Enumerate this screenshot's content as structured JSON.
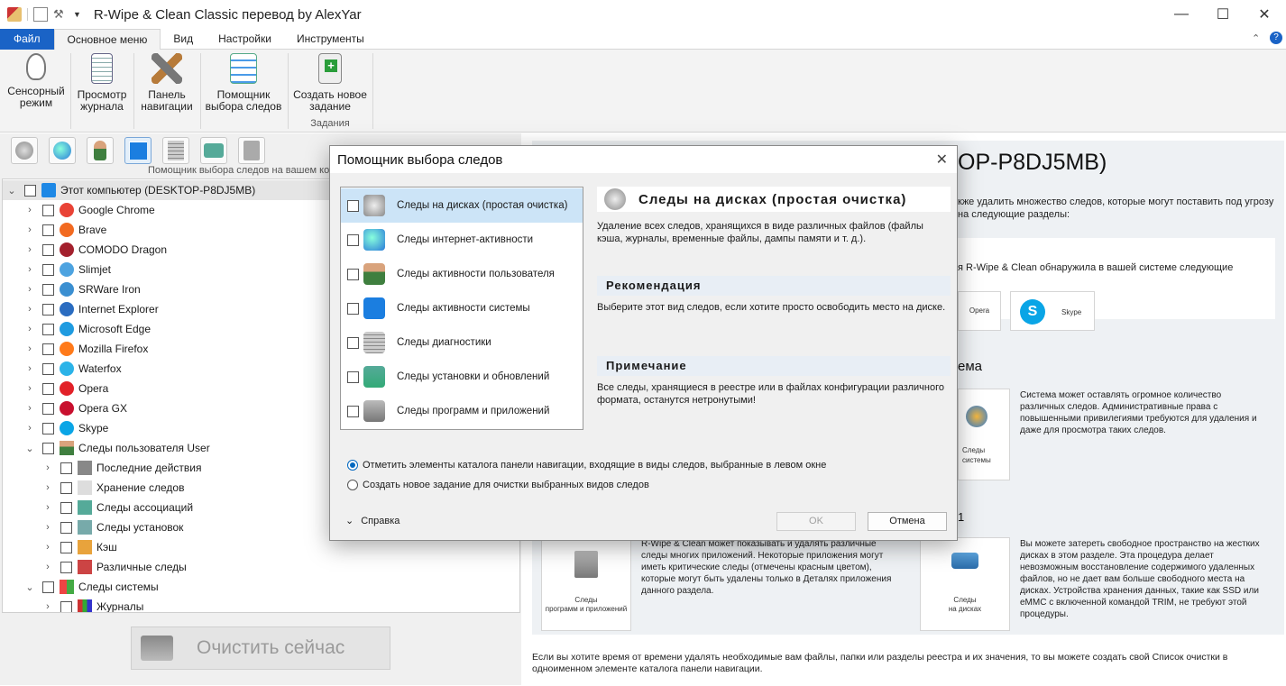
{
  "app": {
    "title": "R-Wipe & Clean Classic перевод by AlexYar"
  },
  "ribbon": {
    "tabs": [
      "Файл",
      "Основное меню",
      "Вид",
      "Настройки",
      "Инструменты"
    ],
    "buttons": [
      {
        "l1": "Сенсорный",
        "l2": "режим"
      },
      {
        "l1": "Просмотр",
        "l2": "журнала"
      },
      {
        "l1": "Панель",
        "l2": "навигации"
      },
      {
        "l1": "Помощник",
        "l2": "выбора следов"
      },
      {
        "l1": "Создать новое",
        "l2": "задание"
      }
    ],
    "group_label": "Задания"
  },
  "left": {
    "toolbar_caption": "Помощник выбора следов на вашем компьютере",
    "root": "Этот компьютер  (DESKTOP-P8DJ5MB)",
    "items": [
      "Google Chrome",
      "Brave",
      "COMODO Dragon",
      "Slimjet",
      "SRWare Iron",
      "Internet  Explorer",
      "Microsoft Edge",
      "Mozilla Firefox",
      "Waterfox",
      "Opera",
      "Opera GX",
      "Skype"
    ],
    "user_group": "Следы пользователя User",
    "user_items": [
      "Последние действия",
      "Хранение следов",
      "Следы ассоциаций",
      "Следы установок",
      "Кэш",
      "Различные следы"
    ],
    "system_group": "Следы системы",
    "system_items": [
      "Журналы"
    ],
    "clean_button": "Очистить сейчас"
  },
  "dialog": {
    "title": "Помощник выбора следов",
    "types": [
      "Следы на дисках (простая очистка)",
      "Следы интернет-активности",
      "Следы активности пользователя",
      "Следы активности системы",
      "Следы диагностики",
      "Следы установки и обновлений",
      "Следы программ и приложений"
    ],
    "detail_title": "Следы на дисках (простая очистка)",
    "detail_desc": "Удаление всех следов, хранящихся в виде различных файлов (файлы кэша, журналы, временные файлы, дампы памяти и т. д.).",
    "rec_head": "Рекомендация",
    "rec_text": "Выберите этот вид следов, если хотите просто освободить место на диске.",
    "note_head": "Примечание",
    "note_text": "Все следы, хранящиеся в реестре или в файлах конфигурации различного формата, останутся нетронутыми!",
    "radio1": "Отметить элементы каталога панели навигации, входящие в виды следов, выбранные в левом окне",
    "radio2": "Создать новое задание для очистки выбранных видов следов",
    "help": "Справка",
    "ok": "OK",
    "cancel": "Отмена"
  },
  "right": {
    "heading": "OP-P8DJ5MB)",
    "intro": "кже удалить множество следов, которые могут поставить под угрозу",
    "intro2": "на следующие разделы:",
    "found": "я R-Wipe & Clean обнаружила в вашей системе следующие",
    "opera": "Opera",
    "skype": "Skype",
    "sys_head": "ема",
    "sys_card": "Следы",
    "sys_card2": "системы",
    "sys_text": "Система может оставлять огромное количество различных следов. Административные права с повышенными привилегиями требуются для удаления и даже для просмотра таких следов.",
    "m_head": "1",
    "apps_text": "R-Wipe & Clean может показывать и удалять различные следы многих приложений. Некоторые приложения могут иметь критические следы (отмечены красным цветом), которые могут быть удалены только в Деталях приложения данного раздела.",
    "apps_card": "Следы",
    "apps_card2": "программ и приложений",
    "disk_text": "Вы можете затереть свободное пространство на жестких дисках в этом разделе. Эта процедура делает невозможным восстановление содержимого удаленных файлов, но не дает вам больше свободного места на дисках. Устройства хранения данных, такие как SSD или eMMC с включенной командой TRIM, не требуют этой процедуры.",
    "disk_card": "Следы",
    "disk_card2": "на дисках",
    "footer": "Если вы хотите время от времени удалять необходимые вам файлы, папки или разделы реестра и их значения, то вы можете создать свой Список очистки в одноименном элементе каталога  панели навигации."
  }
}
